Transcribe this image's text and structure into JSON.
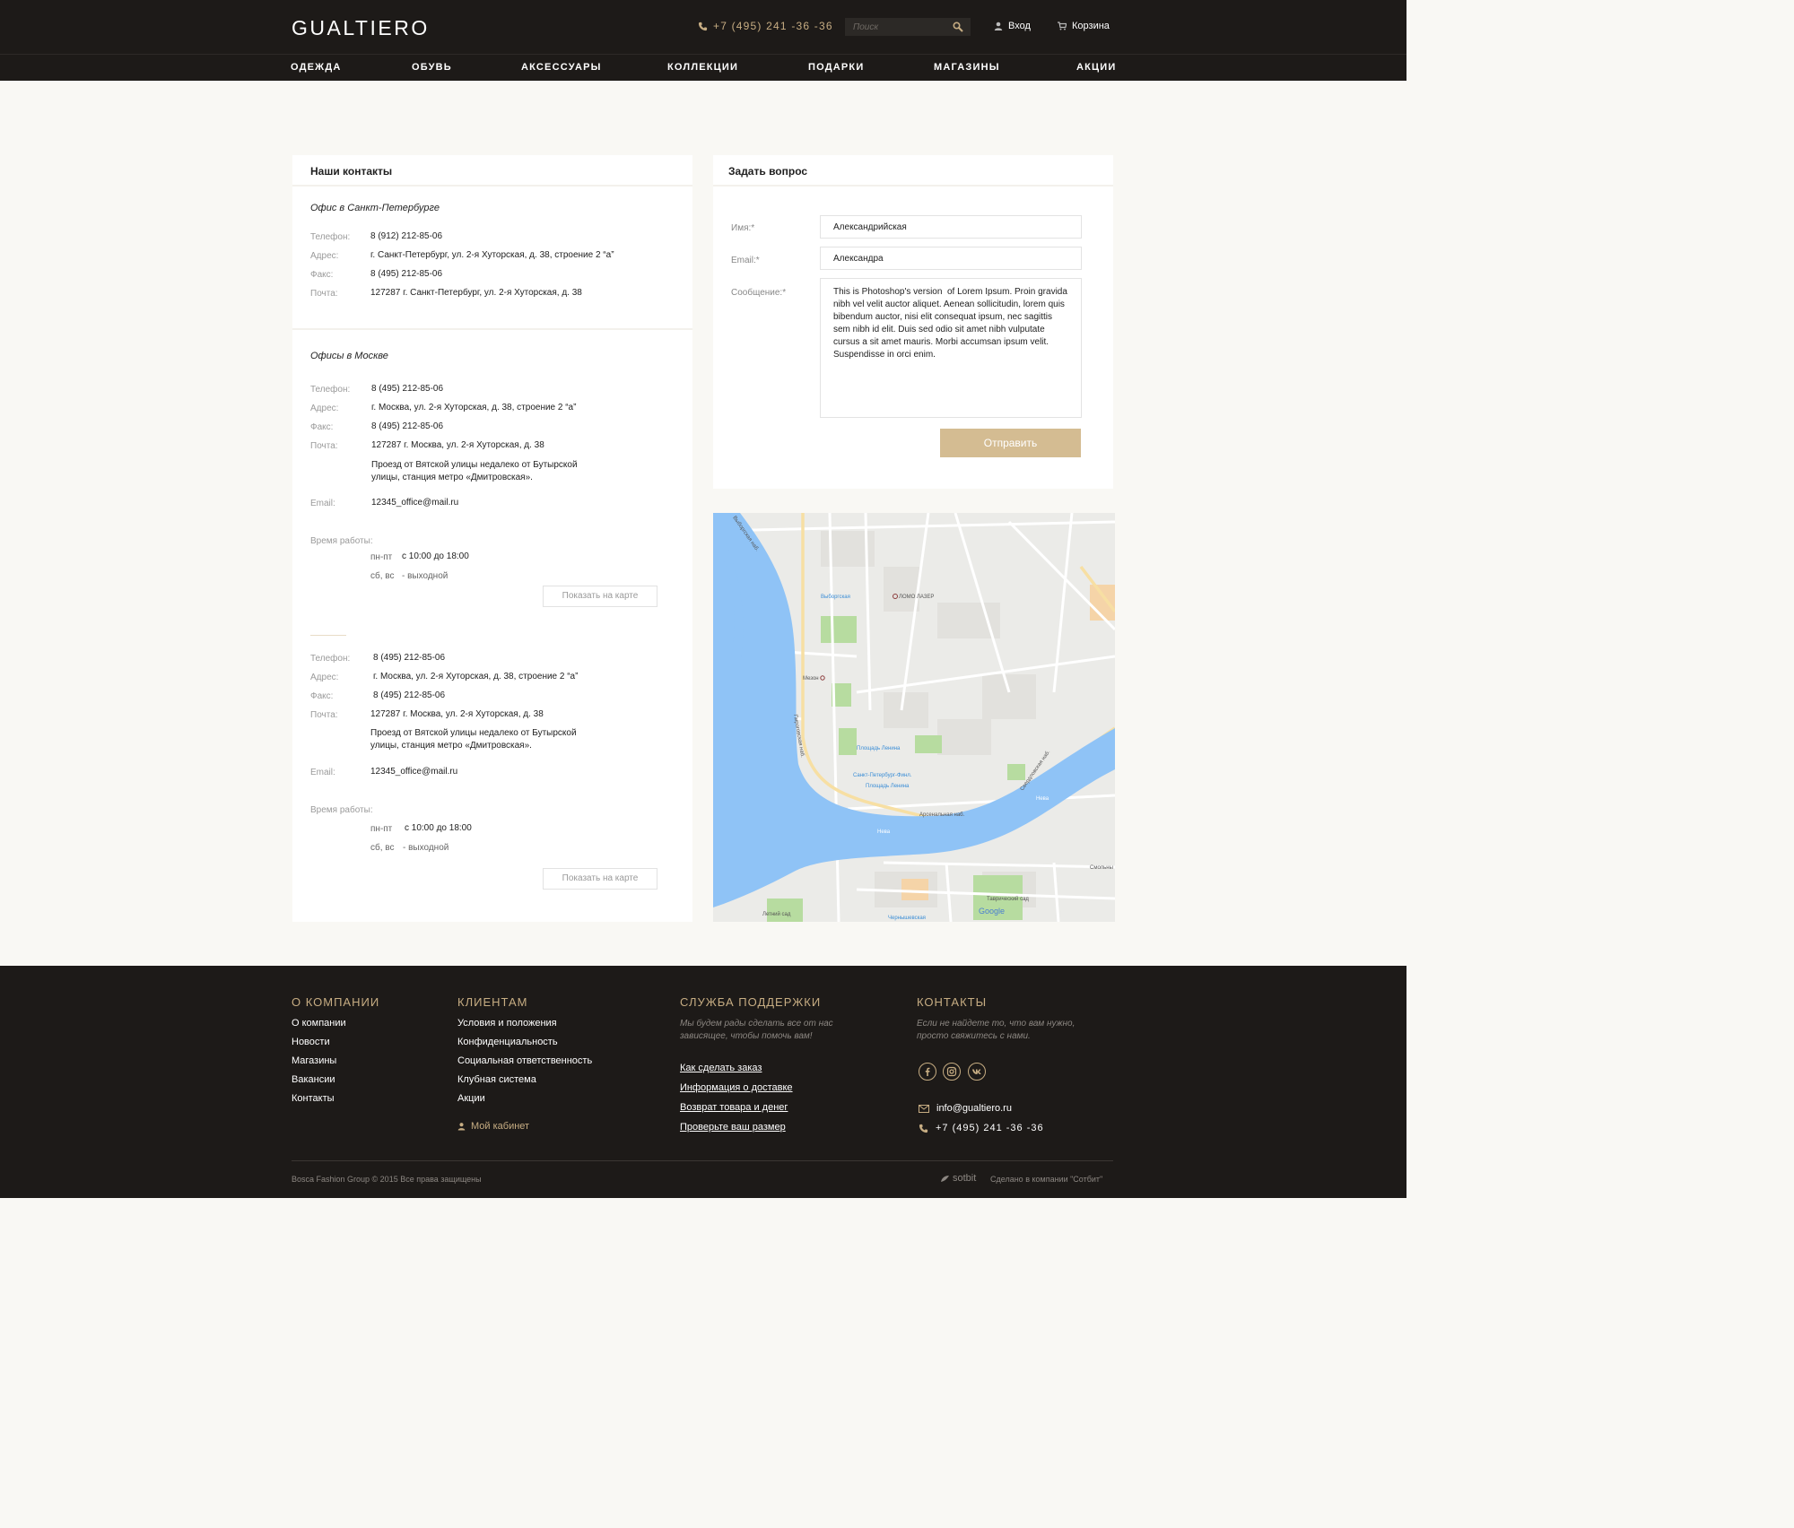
{
  "header": {
    "logo": "GUALTIERO",
    "phone": "+7 (495) 241 -36 -36",
    "search_placeholder": "Поиск",
    "login": "Вход",
    "cart": "Корзина"
  },
  "nav": [
    "ОДЕЖДА",
    "ОБУВЬ",
    "АКСЕССУАРЫ",
    "КОЛЛЕКЦИИ",
    "ПОДАРКИ",
    "МАГАЗИНЫ",
    "АКЦИИ"
  ],
  "contacts": {
    "title": "Наши контакты",
    "spb": {
      "title": "Офис в Санкт-Петербурге",
      "phone_label": "Телефон:",
      "phone": "8 (912) 212-85-06",
      "address_label": "Адрес:",
      "address": "г. Санкт-Петербург, ул. 2-я Хуторская, д. 38, строение 2 “а”",
      "fax_label": "Факс:",
      "fax": "8 (495) 212-85-06",
      "mail_label": "Почта:",
      "mail": "127287 г. Санкт-Петербург, ул. 2-я Хуторская, д. 38"
    },
    "moscow_title": "Офисы в Москве",
    "moscow1": {
      "phone_label": "Телефон:",
      "phone": "8 (495) 212-85-06",
      "address_label": "Адрес:",
      "address": "г. Москва, ул. 2-я Хуторская, д. 38, строение 2 “а”",
      "fax_label": "Факс:",
      "fax": "8 (495) 212-85-06",
      "mail_label": "Почта:",
      "mail": "127287  г. Москва, ул. 2-я Хуторская, д. 38",
      "directions_1": "Проезд от Вятской улицы недалеко от Бутырской",
      "directions_2": "улицы, станция метро «Дмитровская».",
      "email_label": "Email:",
      "email": "12345_office@mail.ru",
      "hours_label": "Время работы:",
      "weekdays": "пн-пт",
      "weekdays_hours": "с 10:00 до 18:00",
      "weekend": "сб, вс",
      "weekend_hours": "- выходной",
      "map_button": "Показать на карте"
    },
    "moscow2": {
      "phone_label": "Телефон:",
      "phone": "8 (495) 212-85-06",
      "address_label": "Адрес:",
      "address": "г. Москва, ул. 2-я Хуторская, д. 38, строение 2 “а”",
      "fax_label": "Факс:",
      "fax": "8 (495) 212-85-06",
      "mail_label": "Почта:",
      "mail": "127287  г. Москва, ул. 2-я Хуторская, д. 38",
      "directions_1": "Проезд от Вятской улицы недалеко от Бутырской",
      "directions_2": "улицы, станция метро «Дмитровская».",
      "email_label": "Email:",
      "email": "12345_office@mail.ru",
      "hours_label": "Время работы:",
      "weekdays": "пн-пт",
      "weekdays_hours": "с 10:00 до 18:00",
      "weekend": "сб, вс",
      "weekend_hours": "- выходной",
      "map_button": "Показать на карте"
    }
  },
  "form": {
    "title": "Задать вопрос",
    "name_label": "Имя:*",
    "name_value": "Александрийская",
    "email_label": "Email:*",
    "email_value": "Александра",
    "message_label": "Сообщение:*",
    "message_value": "This is Photoshop's version  of Lorem Ipsum. Proin gravida nibh vel velit auctor aliquet. Aenean sollicitudin, lorem quis bibendum auctor, nisi elit consequat ipsum, nec sagittis sem nibh id elit. Duis sed odio sit amet nibh vulputate cursus a sit amet mauris. Morbi accumsan ipsum velit. Suspendisse in orci enim.",
    "submit": "Отправить"
  },
  "map": {
    "labels": {
      "vyborgskaya": "Выборгская",
      "lomo": "ЛОМО ЛАЗЕР",
      "mezon": "Мезон",
      "lenin_sq": "Площадь Ленина",
      "finland": "Санкт-Петербург-Финл.",
      "lenin_sq2": "Площадь Ленина",
      "neva": "Нева",
      "neva2": "Нева",
      "smolny": "Смольны",
      "letny": "Летний сад",
      "tavrich": "Таврический сад",
      "chern": "Чернышевская",
      "arsenal": "Арсенальная наб.",
      "pirogov": "Пироговская наб.",
      "sverdl": "Свердловская наб.",
      "vyborg_nab": "Выборгская наб.",
      "google": "Google"
    },
    "colors": {
      "water": "#8fc3f6",
      "park": "#b7dca0",
      "road": "#ffffff",
      "arterial": "#f7dfa3",
      "land": "#ebebe8"
    }
  },
  "footer": {
    "about": {
      "title": "О КОМПАНИИ",
      "links": [
        "О компании",
        "Новости",
        "Магазины",
        "Вакансии",
        "Контакты"
      ]
    },
    "clients": {
      "title": "КЛИЕНТАМ",
      "links": [
        "Условия и положения",
        "Конфиденциальность",
        "Социальная ответственность",
        "Клубная система",
        "Акции"
      ],
      "cabinet": "Мой кабинет"
    },
    "support": {
      "title": "СЛУЖБА ПОДДЕРЖКИ",
      "text_1": "Мы будем рады сделать все от нас",
      "text_2": "зависящее, чтобы помочь вам!",
      "links": [
        "Как сделать заказ",
        "Информация о доставке",
        "Возврат товара и денег",
        "Проверьте ваш размер"
      ]
    },
    "contacts": {
      "title": "КОНТАКТЫ",
      "text_1": "Если не найдете то, что вам нужно,",
      "text_2": "просто свяжитесь с нами.",
      "email": "info@gualtiero.ru",
      "phone": "+7 (495) 241 -36 -36"
    },
    "copyright": "Bosca Fashion Group © 2015  Все права защищены",
    "sotbit": "sotbit",
    "made_by": "Сделано в компании \"Сотбит\"",
    "accent": "#c7ad83"
  }
}
